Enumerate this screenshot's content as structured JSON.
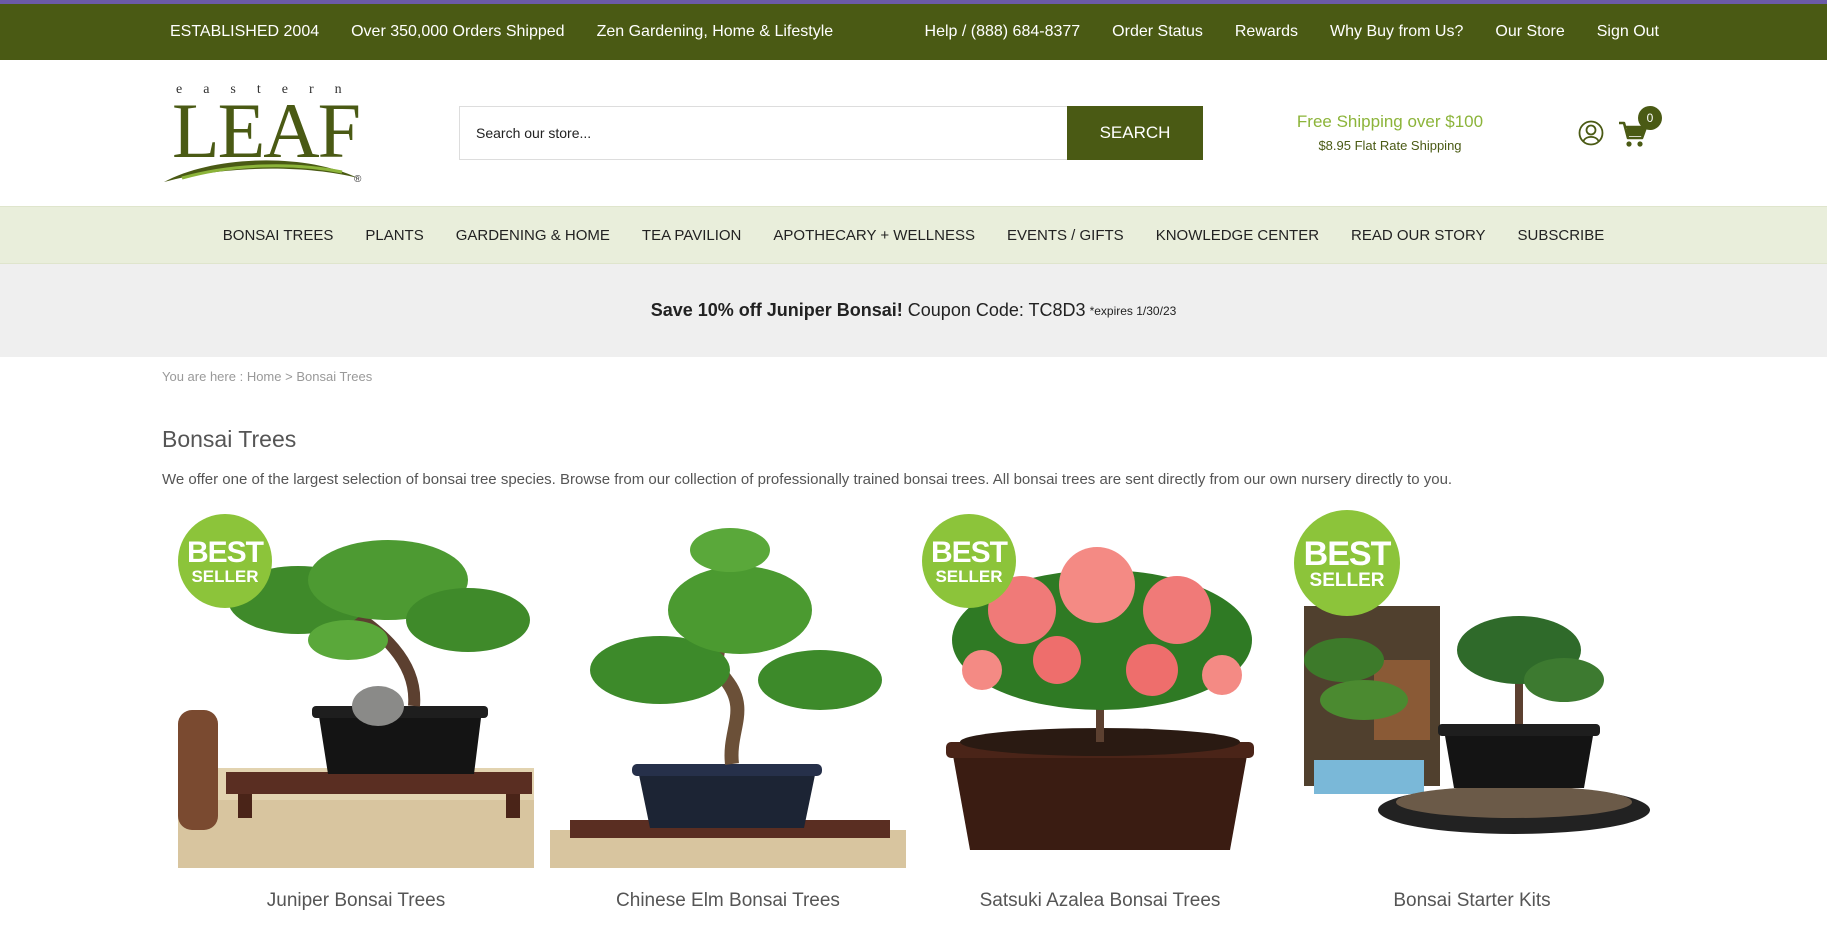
{
  "topbar": {
    "left": [
      "ESTABLISHED 2004",
      "Over 350,000 Orders Shipped",
      "Zen Gardening, Home & Lifestyle"
    ],
    "right": [
      "Help / (888) 684-8377",
      "Order Status",
      "Rewards",
      "Why Buy from Us?",
      "Our Store",
      "Sign Out"
    ]
  },
  "logo": {
    "small": "eastern",
    "big": "LEAF",
    "mark": "®"
  },
  "search": {
    "placeholder": "Search our store...",
    "button": "SEARCH"
  },
  "shipping": {
    "line1": "Free Shipping over $100",
    "line2": "$8.95 Flat Rate Shipping"
  },
  "cart": {
    "count": "0"
  },
  "nav": [
    "BONSAI TREES",
    "PLANTS",
    "GARDENING & HOME",
    "TEA PAVILION",
    "APOTHECARY + WELLNESS",
    "EVENTS / GIFTS",
    "KNOWLEDGE CENTER",
    "READ OUR STORY",
    "SUBSCRIBE"
  ],
  "promo": {
    "bold": "Save 10% off Juniper Bonsai!",
    "code": "Coupon Code: TC8D3",
    "expires": "*expires 1/30/23"
  },
  "breadcrumb": {
    "prefix": "You are here : ",
    "home": "Home",
    "sep": " > ",
    "current": "Bonsai Trees"
  },
  "page": {
    "title": "Bonsai Trees",
    "description": "We offer one of the largest selection of bonsai tree species. Browse from our collection of professionally trained bonsai trees. All bonsai trees are sent directly from our own nursery directly to you."
  },
  "badge": {
    "line1": "BEST",
    "line2": "SELLER"
  },
  "products": [
    {
      "name": "Juniper Bonsai Trees"
    },
    {
      "name": "Chinese Elm Bonsai Trees"
    },
    {
      "name": "Satsuki Azalea Bonsai Trees"
    },
    {
      "name": "Bonsai Starter Kits"
    }
  ],
  "colors": {
    "brand": "#4a5a14",
    "accent": "#8cb43a",
    "badge": "#8cc43a"
  }
}
